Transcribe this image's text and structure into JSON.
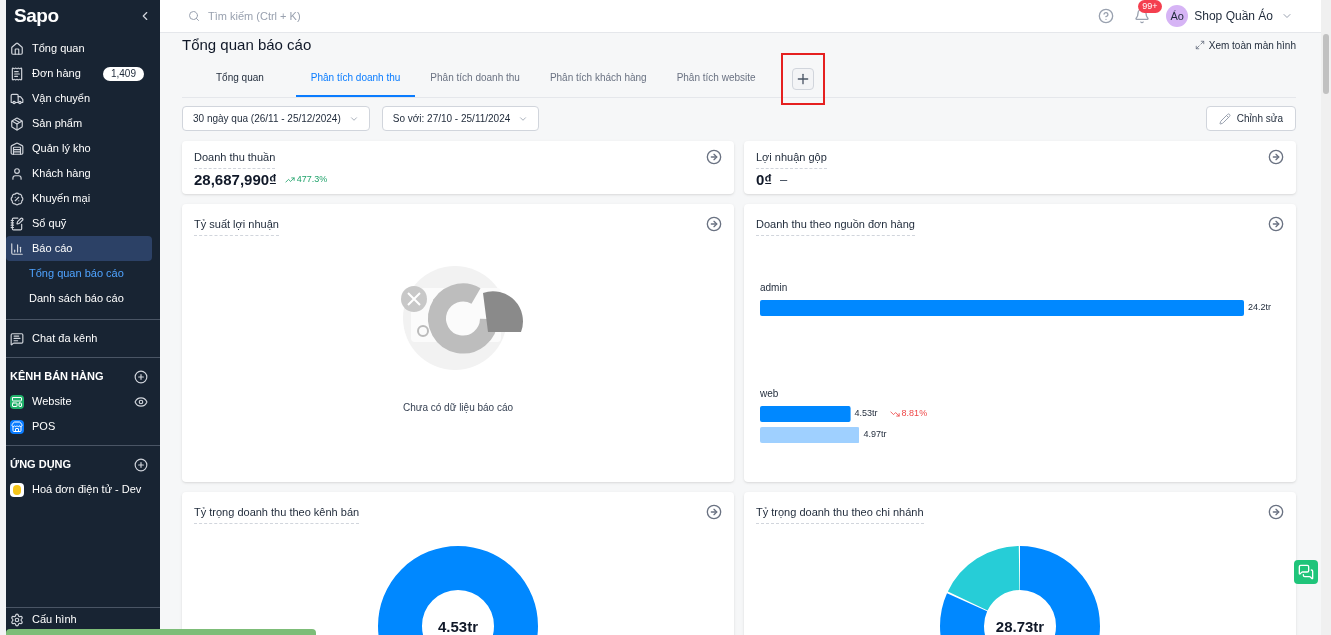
{
  "sidebar": {
    "logo": "Sapo",
    "items": [
      {
        "label": "Tổng quan",
        "selected": false
      },
      {
        "label": "Đơn hàng",
        "badge": "1,409",
        "selected": false
      },
      {
        "label": "Vận chuyển",
        "selected": false
      },
      {
        "label": "Sản phẩm",
        "selected": false
      },
      {
        "label": "Quản lý kho",
        "selected": false
      },
      {
        "label": "Khách hàng",
        "selected": false
      },
      {
        "label": "Khuyến mại",
        "selected": false
      },
      {
        "label": "Sổ quỹ",
        "selected": false
      },
      {
        "label": "Báo cáo",
        "selected": true,
        "children": [
          {
            "label": "Tổng quan báo cáo",
            "selected": true
          },
          {
            "label": "Danh sách báo cáo",
            "selected": false
          }
        ]
      }
    ],
    "chat": {
      "label": "Chat đa kênh"
    },
    "sections": [
      {
        "title": "KÊNH BÁN HÀNG",
        "items": [
          {
            "label": "Website",
            "kind": "website"
          },
          {
            "label": "POS",
            "kind": "pos"
          }
        ]
      },
      {
        "title": "ỨNG DỤNG",
        "items": [
          {
            "label": "Hoá đơn điện tử - Dev",
            "kind": "app"
          }
        ]
      }
    ],
    "footer": {
      "label": "Cấu hình"
    }
  },
  "header": {
    "search": {
      "placeholder": "Tìm kiếm (Ctrl + K)"
    },
    "notifications": "99+",
    "avatar": "Áo",
    "shop": "Shop Quần Áo"
  },
  "page": {
    "title": "Tổng quan báo cáo",
    "fullscreen": "Xem toàn màn hình",
    "tabs": [
      {
        "label": "Tổng quan",
        "selected": false
      },
      {
        "label": "Phân tích doanh thu",
        "selected": true
      },
      {
        "label": "Phân tích doanh thu",
        "selected": false
      },
      {
        "label": "Phân tích khách hàng",
        "selected": false
      },
      {
        "label": "Phân tích website",
        "selected": false
      }
    ],
    "filters": [
      "30 ngày qua (26/11 - 25/12/2024)",
      "So với: 27/10 - 25/11/2024"
    ],
    "edit_button": "Chỉnh sửa"
  },
  "stats": [
    {
      "title": "Doanh thu thuần",
      "value": "28,687,990₫",
      "change": "477.3%",
      "kind": "up"
    },
    {
      "title": "Lợi nhuận gộp",
      "value": "0₫",
      "change": "–",
      "kind": "flat"
    }
  ],
  "profit_card": {
    "title": "Tỷ suất lợi nhuận",
    "empty": "Chưa có dữ liệu báo cáo"
  },
  "source_card": {
    "title": "Doanh thu theo nguồn đơn hàng",
    "chart_data": {
      "type": "bar",
      "orientation": "horizontal",
      "categories": [
        "admin",
        "web"
      ],
      "series": [
        {
          "color": "#0088ff",
          "values": [
            24.2,
            4.53
          ],
          "value_labels": [
            "24.2tr",
            "4.53tr"
          ]
        },
        {
          "color": "#9fd0ff",
          "values": [
            null,
            4.97
          ],
          "value_labels": [
            null,
            "4.97tr"
          ]
        }
      ]
    },
    "last_change": {
      "text": "8.81%",
      "kind": "down"
    }
  },
  "donuts": [
    {
      "title": "Tỷ trọng doanh thu theo kênh bán",
      "center": "4.53tr"
    },
    {
      "title": "Tỷ trọng doanh thu theo chi nhánh",
      "center": "28.73tr"
    }
  ]
}
